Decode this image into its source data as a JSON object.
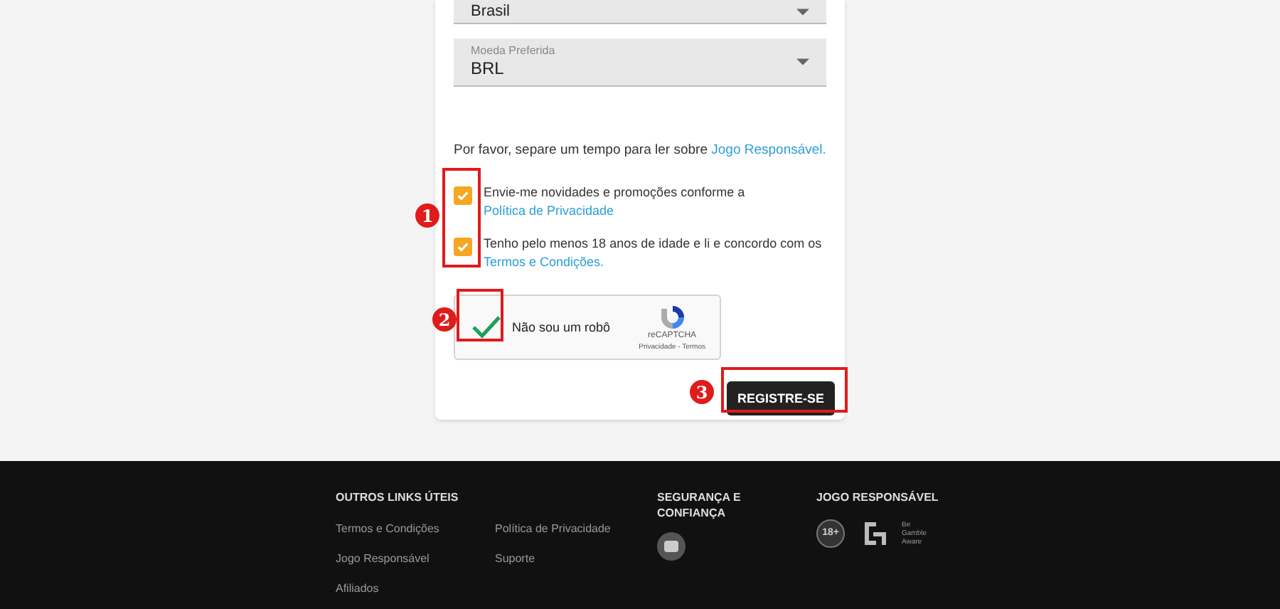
{
  "form": {
    "country_field": {
      "value": "Brasil"
    },
    "currency_field": {
      "label": "Moeda Preferida",
      "value": "BRL"
    },
    "notice": {
      "text": "Por favor, separe um tempo para ler sobre ",
      "link": "Jogo Responsável."
    },
    "checkboxes": [
      {
        "text": "Envie-me novidades e promoções conforme a ",
        "link": "Política de Privacidade",
        "checked": true
      },
      {
        "text": "Tenho pelo menos 18 anos de idade e li e concordo com os ",
        "link": "Termos e Condições.",
        "checked": true
      }
    ],
    "captcha": {
      "label": "Não sou um robô",
      "checked": true,
      "brand": "reCAPTCHA",
      "links": "Privacidade - Termos"
    },
    "submit": "REGISTRE-SE"
  },
  "annotations": [
    {
      "number": "1"
    },
    {
      "number": "2"
    },
    {
      "number": "3"
    }
  ],
  "footer": {
    "columns": [
      {
        "title": "OUTROS LINKS ÚTEIS",
        "links": [
          "Termos e Condições",
          "Jogo Responsável",
          "Afiliados",
          "Política de Privacidade",
          "Suporte"
        ]
      },
      {
        "title": "SEGURANÇA E CONFIANÇA"
      },
      {
        "title": "JOGO RESPONSÁVEL",
        "badge": "18+",
        "logo_text": "Be Gamble Aware"
      }
    ]
  }
}
